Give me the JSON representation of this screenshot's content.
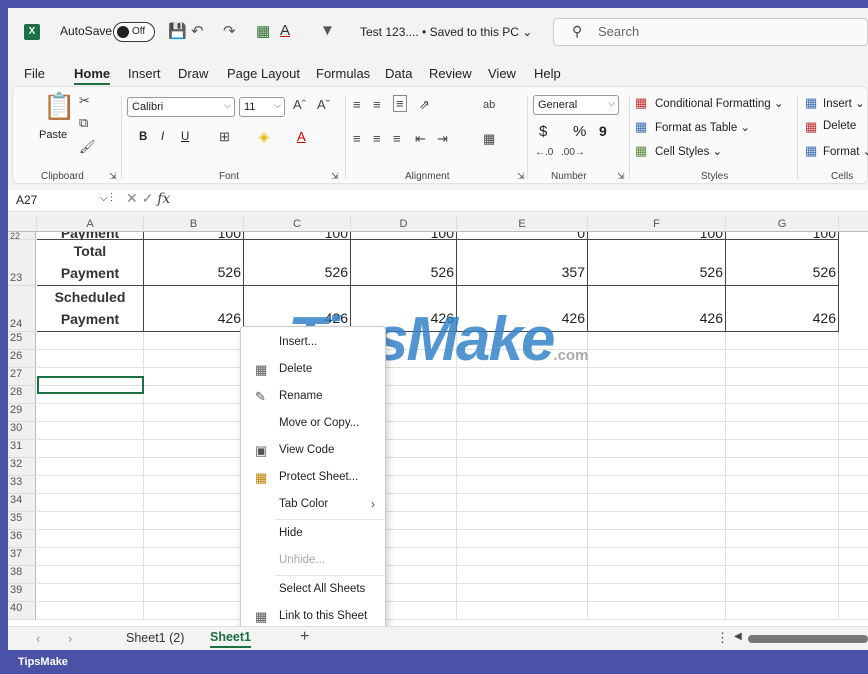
{
  "titlebar": {
    "autosave_label": "AutoSave",
    "autosave_state": "Off",
    "doc_title": "Test 123.... • Saved to this PC ⌄",
    "search_placeholder": "Search"
  },
  "menu": [
    "File",
    "Home",
    "Insert",
    "Draw",
    "Page Layout",
    "Formulas",
    "Data",
    "Review",
    "View",
    "Help"
  ],
  "menu_active": "Home",
  "ribbon": {
    "clipboard": {
      "paste": "Paste",
      "group": "Clipboard"
    },
    "font": {
      "name": "Calibri",
      "size": "11",
      "group": "Font",
      "bold": "B",
      "italic": "I",
      "underline": "U"
    },
    "alignment": {
      "group": "Alignment"
    },
    "number": {
      "format": "General",
      "currency": "$",
      "percent": "%",
      "comma": "9",
      "group": "Number"
    },
    "styles": {
      "conditional": "Conditional Formatting ⌄",
      "format_table": "Format as Table ⌄",
      "cell_styles": "Cell Styles ⌄",
      "group": "Styles"
    },
    "cells": {
      "insert": "Insert ⌄",
      "delete": "Delete",
      "format": "Format ⌄",
      "group": "Cells"
    }
  },
  "formulabar": {
    "namebox": "A27",
    "fx": "fx"
  },
  "columns": [
    "A",
    "B",
    "C",
    "D",
    "E",
    "F",
    "G"
  ],
  "rows_partial": {
    "num": "22",
    "label": "Payment",
    "values": [
      "100",
      "100",
      "100",
      "0",
      "100",
      "100"
    ]
  },
  "row23": {
    "num": "23",
    "label1": "Total",
    "label2": "Payment",
    "values": [
      "526",
      "526",
      "526",
      "357",
      "526",
      "526"
    ]
  },
  "row24": {
    "num": "24",
    "label1": "Scheduled",
    "label2": "Payment",
    "values": [
      "426",
      "426",
      "426",
      "426",
      "426",
      "426"
    ]
  },
  "empty_rows": [
    "25",
    "26",
    "27",
    "28",
    "29",
    "30",
    "31",
    "32",
    "33",
    "34",
    "35",
    "36",
    "37",
    "38",
    "39",
    "40"
  ],
  "watermark": {
    "text": "TipsMake",
    ".com": ".com"
  },
  "context_menu": [
    {
      "label": "Insert...",
      "icon": "",
      "enabled": true
    },
    {
      "label": "Delete",
      "icon": "delete-sheet-icon",
      "enabled": true
    },
    {
      "label": "Rename",
      "icon": "rename-icon",
      "enabled": true
    },
    {
      "label": "Move or Copy...",
      "icon": "",
      "enabled": true
    },
    {
      "label": "View Code",
      "icon": "view-code-icon",
      "enabled": true
    },
    {
      "label": "Protect Sheet...",
      "icon": "protect-sheet-icon",
      "enabled": true
    },
    {
      "label": "Tab Color",
      "icon": "",
      "enabled": true,
      "submenu": true
    },
    {
      "label": "Hide",
      "icon": "",
      "enabled": true
    },
    {
      "label": "Unhide...",
      "icon": "",
      "enabled": false
    },
    {
      "label": "Select All Sheets",
      "icon": "",
      "enabled": true
    },
    {
      "label": "Link to this Sheet",
      "icon": "link-icon",
      "enabled": true
    }
  ],
  "tabs": {
    "sheet1_2": "Sheet1 (2)",
    "sheet1": "Sheet1",
    "add": "+"
  },
  "footer_brand": "TipsMake"
}
